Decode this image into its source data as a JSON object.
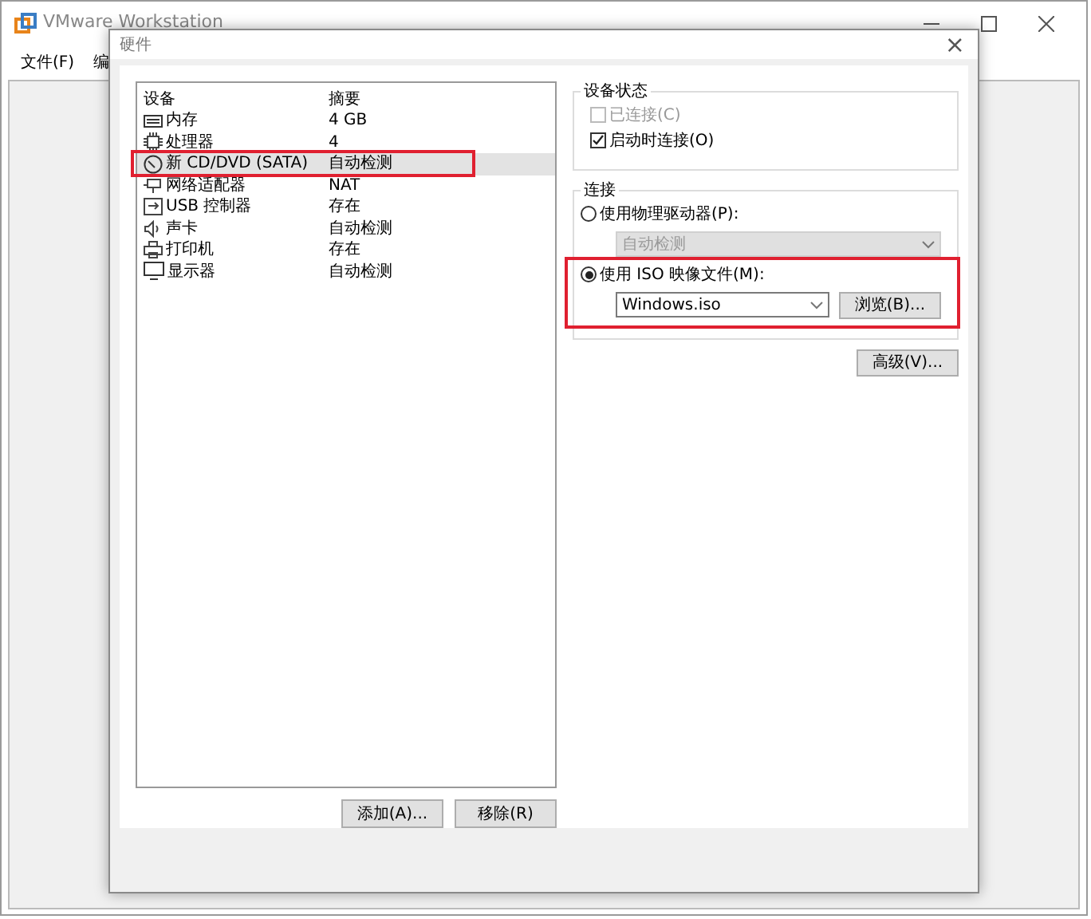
{
  "main_window": {
    "title": "VMware Workstation",
    "menu": [
      "文件(F)",
      "编"
    ]
  },
  "dialog": {
    "title": "硬件",
    "close": "×"
  },
  "devices": {
    "columns": [
      "设备",
      "摘要"
    ],
    "rows": [
      {
        "kind": "memory",
        "name": "内存",
        "summary": "4 GB",
        "selected": false,
        "highlighted": false
      },
      {
        "kind": "cpu",
        "name": "处理器",
        "summary": "4",
        "selected": false,
        "highlighted": false
      },
      {
        "kind": "disc",
        "name": "新 CD/DVD (SATA)",
        "summary": "自动检测",
        "selected": true,
        "highlighted": true
      },
      {
        "kind": "network",
        "name": "网络适配器",
        "summary": "NAT",
        "selected": false,
        "highlighted": false
      },
      {
        "kind": "usb",
        "name": "USB 控制器",
        "summary": "存在",
        "selected": false,
        "highlighted": false
      },
      {
        "kind": "sound",
        "name": "声卡",
        "summary": "自动检测",
        "selected": false,
        "highlighted": false
      },
      {
        "kind": "printer",
        "name": "打印机",
        "summary": "存在",
        "selected": false,
        "highlighted": false
      },
      {
        "kind": "display",
        "name": "显示器",
        "summary": "自动检测",
        "selected": false,
        "highlighted": false
      }
    ],
    "buttons": [
      "添加(A)...",
      "移除(R)"
    ]
  },
  "device_status": {
    "title": "设备状态",
    "options": [
      {
        "label": "已连接(C)",
        "checked": false,
        "disabled": true
      },
      {
        "label": "启动时连接(O)",
        "checked": true,
        "disabled": false
      }
    ]
  },
  "connection": {
    "title": "连接",
    "options": [
      {
        "label": "使用物理驱动器(P):",
        "selected": false,
        "highlighted": false,
        "value": "自动检测",
        "disabled": true
      },
      {
        "label": "使用 ISO 映像文件(M):",
        "selected": true,
        "highlighted": true,
        "value": "Windows.iso",
        "disabled": false,
        "browse": "浏览(B)..."
      }
    ],
    "advanced": "高级(V)..."
  }
}
